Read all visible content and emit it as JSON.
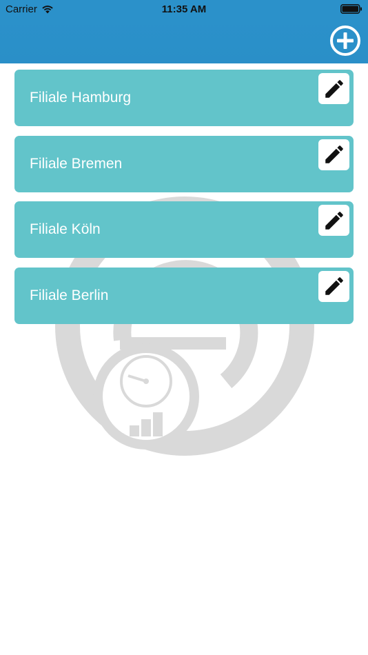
{
  "status_bar": {
    "carrier": "Carrier",
    "time": "11:35 AM",
    "wifi_icon": "wifi-icon",
    "battery_icon": "battery-icon"
  },
  "nav": {
    "add_icon": "plus-circle-icon"
  },
  "branches": [
    {
      "label": "Filiale Hamburg",
      "edit_icon": "pencil-icon"
    },
    {
      "label": "Filiale Bremen",
      "edit_icon": "pencil-icon"
    },
    {
      "label": "Filiale Köln",
      "edit_icon": "pencil-icon"
    },
    {
      "label": "Filiale Berlin",
      "edit_icon": "pencil-icon"
    }
  ],
  "colors": {
    "nav_background": "#2b91ca",
    "item_background": "#62c4ca",
    "item_text": "#ffffff",
    "watermark": "#d9d9d9"
  }
}
